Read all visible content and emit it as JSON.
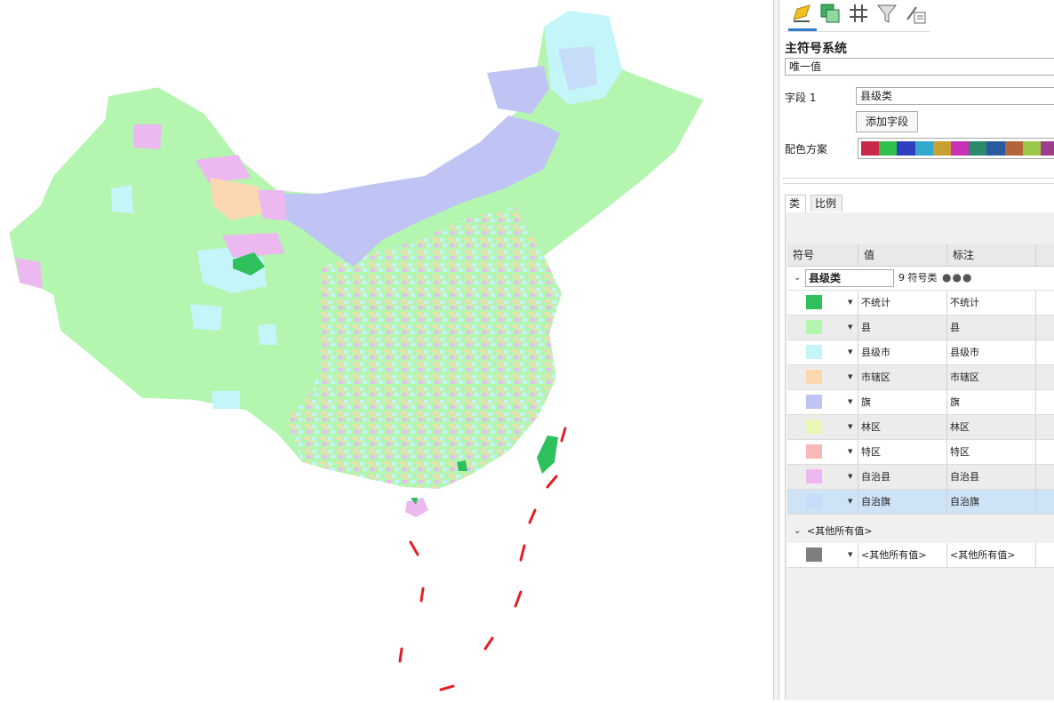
{
  "map": {
    "region_colors": {
      "no_stat": "#2ec05c",
      "county": "#b4f5b0",
      "county_city": "#c4f5f8",
      "district": "#fcd8b0",
      "banner": "#c0c4f5",
      "forest": "#e8f6b6",
      "special": "#f8b8b8",
      "auto_county": "#ecb8f0",
      "auto_banner": "#c7dcf8",
      "nine_dash_line": "#e41e26"
    }
  },
  "toolbar": {
    "icons": [
      "primary-symbology-icon",
      "vary-symbology-icon",
      "symbol-layers-icon",
      "filter-icon",
      "advanced-icon"
    ]
  },
  "symbology": {
    "title": "主符号系统",
    "method": "唯一值",
    "field_label": "字段 1",
    "field_value": "县级类",
    "add_field_label": "添加字段",
    "color_scheme_label": "配色方案",
    "ramp_colors": [
      "#c8294b",
      "#30c04c",
      "#2f3fbf",
      "#32a8cf",
      "#c8a032",
      "#c832b4",
      "#2c8a6a",
      "#2c5aa2",
      "#b4643a",
      "#9cc848",
      "#a03c8c"
    ]
  },
  "tabs": [
    "类",
    "比例"
  ],
  "table": {
    "headers": {
      "symbol": "符号",
      "value": "值",
      "label": "标注"
    },
    "group_name": "县级类",
    "group_count": "9 符号类",
    "group_more": "●●●",
    "rows": [
      {
        "value": "不统计",
        "label": "不统计",
        "color": "#2ec05c"
      },
      {
        "value": "县",
        "label": "县",
        "color": "#b4f5b0"
      },
      {
        "value": "县级市",
        "label": "县级市",
        "color": "#c4f5f8"
      },
      {
        "value": "市辖区",
        "label": "市辖区",
        "color": "#fcd8b0"
      },
      {
        "value": "旗",
        "label": "旗",
        "color": "#c0c4f5"
      },
      {
        "value": "林区",
        "label": "林区",
        "color": "#e8f6b6"
      },
      {
        "value": "特区",
        "label": "特区",
        "color": "#f8b8b8"
      },
      {
        "value": "自治县",
        "label": "自治县",
        "color": "#ecb8f0"
      },
      {
        "value": "自治旗",
        "label": "自治旗",
        "color": "#c7dcf8"
      }
    ],
    "other_group": "<其他所有值>",
    "other_row": {
      "value": "<其他所有值>",
      "label": "<其他所有值>",
      "color": "#7f7f7f"
    }
  }
}
